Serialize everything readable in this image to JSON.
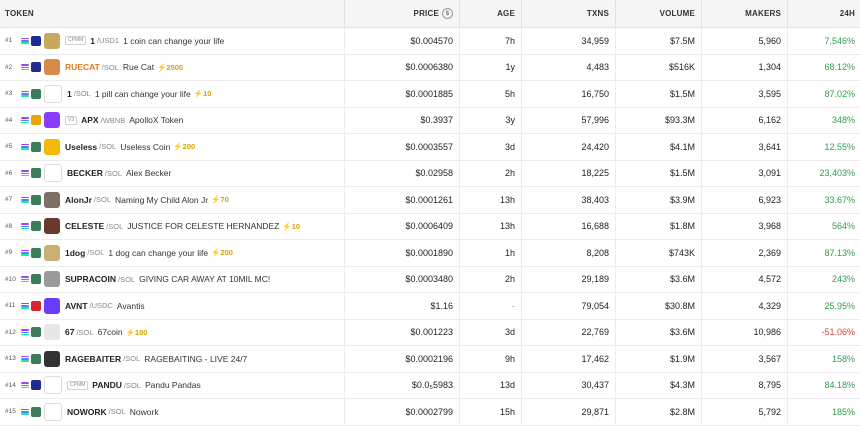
{
  "headers": {
    "token": "TOKEN",
    "price": "PRICE",
    "age": "AGE",
    "txns": "TXNS",
    "volume": "VOLUME",
    "makers": "MAKERS",
    "h24": "24H"
  },
  "rows": [
    {
      "rank": "#1",
      "tag": "CPMM",
      "sym": "1",
      "quote": "/USD1",
      "name": "1 coin can change your life",
      "boost": "",
      "price": "$0.004570",
      "age": "7h",
      "txns": "34,959",
      "volume": "$7.5M",
      "makers": "5,960",
      "h24": "7,546%",
      "dir": "pos",
      "avatar_color": "#c8a85a",
      "dex_color": "#1e2b8f"
    },
    {
      "rank": "#2",
      "tag": "",
      "sym": "RUECAT",
      "quote": "/SOL",
      "name": "Rue Cat",
      "boost": "⚡2500",
      "price": "$0.0006380",
      "age": "1y",
      "txns": "4,483",
      "volume": "$516K",
      "makers": "1,304",
      "h24": "68.12%",
      "dir": "pos",
      "avatar_color": "#d88a4a",
      "dex_color": "#1e2b8f"
    },
    {
      "rank": "#3",
      "tag": "",
      "sym": "1",
      "quote": "/SOL",
      "name": "1 pill can change your life",
      "boost": "⚡10",
      "price": "$0.0001885",
      "age": "5h",
      "txns": "16,750",
      "volume": "$1.5M",
      "makers": "3,595",
      "h24": "87.02%",
      "dir": "pos",
      "avatar_color": "#ffffff",
      "dex_color": "#3a7d5a"
    },
    {
      "rank": "#4",
      "tag": "V3",
      "sym": "APX",
      "quote": "/WBNB",
      "name": "ApolloX Token",
      "boost": "",
      "price": "$0.3937",
      "age": "3y",
      "txns": "57,996",
      "volume": "$93.3M",
      "makers": "6,162",
      "h24": "348%",
      "dir": "pos",
      "avatar_color": "#8a3cff",
      "dex_color": "#e8a400"
    },
    {
      "rank": "#5",
      "tag": "",
      "sym": "Useless",
      "quote": "/SOL",
      "name": "Useless Coin",
      "boost": "⚡200",
      "price": "$0.0003557",
      "age": "3d",
      "txns": "24,420",
      "volume": "$4.1M",
      "makers": "3,641",
      "h24": "12.55%",
      "dir": "pos",
      "avatar_color": "#f2b90a",
      "dex_color": "#3a7d5a"
    },
    {
      "rank": "#6",
      "tag": "",
      "sym": "BECKER",
      "quote": "/SOL",
      "name": "Alex Becker",
      "boost": "",
      "price": "$0.02958",
      "age": "2h",
      "txns": "18,225",
      "volume": "$1.5M",
      "makers": "3,091",
      "h24": "23,403%",
      "dir": "pos",
      "avatar_color": "#ffffff",
      "dex_color": "#3a7d5a"
    },
    {
      "rank": "#7",
      "tag": "",
      "sym": "AlonJr",
      "quote": "/SOL",
      "name": "Naming My Child Alon Jr",
      "boost": "⚡70",
      "price": "$0.0001261",
      "age": "13h",
      "txns": "38,403",
      "volume": "$3.9M",
      "makers": "6,923",
      "h24": "33.67%",
      "dir": "pos",
      "avatar_color": "#7b6f66",
      "dex_color": "#3a7d5a"
    },
    {
      "rank": "#8",
      "tag": "",
      "sym": "CELESTE",
      "quote": "/SOL",
      "name": "JUSTICE FOR CELESTE HERNANDEZ",
      "boost": "⚡10",
      "price": "$0.0006409",
      "age": "13h",
      "txns": "16,688",
      "volume": "$1.8M",
      "makers": "3,968",
      "h24": "564%",
      "dir": "pos",
      "avatar_color": "#6b3a2e",
      "dex_color": "#3a7d5a"
    },
    {
      "rank": "#9",
      "tag": "",
      "sym": "1dog",
      "quote": "/SOL",
      "name": "1 dog can change your life",
      "boost": "⚡200",
      "price": "$0.0001890",
      "age": "1h",
      "txns": "8,208",
      "volume": "$743K",
      "makers": "2,369",
      "h24": "87.13%",
      "dir": "pos",
      "avatar_color": "#c9b074",
      "dex_color": "#3a7d5a"
    },
    {
      "rank": "#10",
      "tag": "",
      "sym": "SUPRACOIN",
      "quote": "/SOL",
      "name": "GIVING CAR AWAY AT 10MIL MC!",
      "boost": "",
      "price": "$0.0003480",
      "age": "2h",
      "txns": "29,189",
      "volume": "$3.6M",
      "makers": "4,572",
      "h24": "243%",
      "dir": "pos",
      "avatar_color": "#9a9a9a",
      "dex_color": "#3a7d5a"
    },
    {
      "rank": "#11",
      "tag": "",
      "sym": "AVNT",
      "quote": "/USDC",
      "name": "Avantis",
      "boost": "",
      "price": "$1.16",
      "age": "-",
      "txns": "79,054",
      "volume": "$30.8M",
      "makers": "4,329",
      "h24": "25.95%",
      "dir": "pos",
      "avatar_color": "#6a3cff",
      "dex_color": "#d8262c"
    },
    {
      "rank": "#12",
      "tag": "",
      "sym": "67",
      "quote": "/SOL",
      "name": "67coin",
      "boost": "⚡100",
      "price": "$0.001223",
      "age": "3d",
      "txns": "22,769",
      "volume": "$3.6M",
      "makers": "10,986",
      "h24": "-51.06%",
      "dir": "neg",
      "avatar_color": "#e6e6e6",
      "dex_color": "#3a7d5a"
    },
    {
      "rank": "#13",
      "tag": "",
      "sym": "RAGEBAITER",
      "quote": "/SOL",
      "name": "RAGEBAITING - LIVE 24/7",
      "boost": "",
      "price": "$0.0002196",
      "age": "9h",
      "txns": "17,462",
      "volume": "$1.9M",
      "makers": "3,567",
      "h24": "158%",
      "dir": "pos",
      "avatar_color": "#333333",
      "dex_color": "#3a7d5a"
    },
    {
      "rank": "#14",
      "tag": "CPMM",
      "sym": "PANDU",
      "quote": "/SOL",
      "name": "Pandu Pandas",
      "boost": "",
      "price": "$0.0₅5983",
      "age": "13d",
      "txns": "30,437",
      "volume": "$4.3M",
      "makers": "8,795",
      "h24": "84.18%",
      "dir": "pos",
      "avatar_color": "#ffffff",
      "dex_color": "#1e2b8f"
    },
    {
      "rank": "#15",
      "tag": "",
      "sym": "NOWORK",
      "quote": "/SOL",
      "name": "Nowork",
      "boost": "",
      "price": "$0.0002799",
      "age": "15h",
      "txns": "29,871",
      "volume": "$2.8M",
      "makers": "5,792",
      "h24": "185%",
      "dir": "pos",
      "avatar_color": "#ffffff",
      "dex_color": "#3a7d5a"
    }
  ],
  "colors": {
    "positive": "#2e9e4f",
    "negative": "#d94141",
    "boost": "#d4a300",
    "highlight_symbol": "#e07b1a"
  }
}
